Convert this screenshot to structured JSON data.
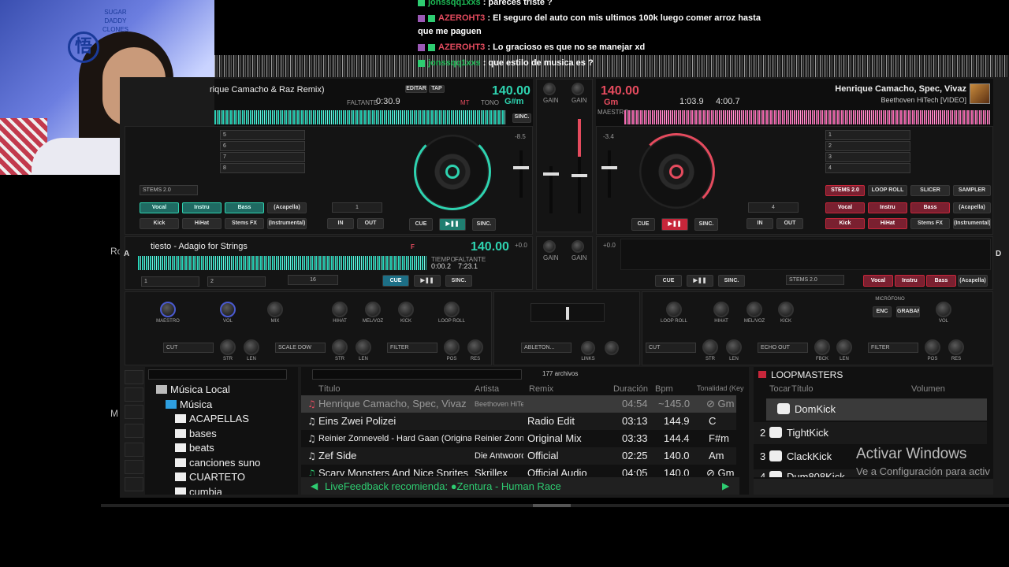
{
  "chat": {
    "messages": [
      {
        "user": "jonssqq1xxs",
        "text": "pareces triste ?"
      },
      {
        "user": "AZEROHT3",
        "text": "El seguro del auto con mis ultimos 100k luego comer arroz hasta"
      },
      {
        "user": "",
        "text": "que me paguen"
      },
      {
        "user": "AZEROHT3",
        "text": "Lo gracioso es que no se manejar xd"
      },
      {
        "user": "jonssqq1xxs",
        "text": "que estilo de musica es ?"
      }
    ]
  },
  "webcam": {
    "logo": "悟",
    "text": "SUGAR\nDADDY\nCLONES"
  },
  "deckA": {
    "title": "rique Camacho & Raz Remix)",
    "bpm": "140.00",
    "key": "G#m",
    "remaining_label": "FALTANTE",
    "remaining": "0:30.9",
    "edit_label": "EDITAR",
    "tap_label": "TAP",
    "mt_label": "MT",
    "tone_label": "TONO",
    "sync_label": "SINC.",
    "pitch": "-8.5",
    "stems": "STEMS 2.0",
    "stem_buttons": [
      "Vocal",
      "Instru",
      "Bass",
      "(Acapella)",
      "Kick",
      "HiHat",
      "Stems FX",
      "(Instrumental)"
    ],
    "loop_value": "1",
    "in_label": "IN",
    "out_label": "OUT",
    "cue_label": "CUE",
    "gain_label": "GAIN",
    "pads": [
      "5",
      "6",
      "7",
      "8"
    ]
  },
  "deckB": {
    "title": "Henrique Camacho, Spec, Vivaz",
    "subtitle": "Beethoven HiTech [VIDEO]",
    "bpm": "140.00",
    "key": "Gm",
    "elapsed": "1:03.9",
    "total": "4:00.7",
    "maestro_label": "MAESTRO",
    "pitch": "-3.4",
    "stems": "STEMS 2.0",
    "top_buttons": [
      "LOOP ROLL",
      "SLICER",
      "SAMPLER"
    ],
    "stem_buttons": [
      "Vocal",
      "Instru",
      "Bass",
      "(Acapella)",
      "Kick",
      "HiHat",
      "Stems FX",
      "(Instrumental)"
    ],
    "loop_value": "4",
    "in_label": "IN",
    "out_label": "OUT",
    "cue_label": "CUE",
    "sync_label": "SINC.",
    "pads": [
      "1",
      "2",
      "3",
      "4"
    ]
  },
  "deckC": {
    "letter": "A",
    "title": "tiesto - Adagio for Strings",
    "bpm": "140.00",
    "key": "F",
    "elapsed_label": "TIEMPO",
    "elapsed": "0:00.2",
    "remaining_label": "FALTANTE",
    "remaining": "7:23.1",
    "loop_value": "16",
    "cue_label": "CUE",
    "sync_label": "SINC.",
    "pitch": "+0.0",
    "pads": [
      "1",
      "2"
    ]
  },
  "deckD": {
    "letter": "D",
    "pitch": "+0.0",
    "stems": "STEMS 2.0",
    "stem_buttons": [
      "Vocal",
      "Instru",
      "Bass",
      "(Acapella)"
    ],
    "cue_label": "CUE",
    "sync_label": "SINC."
  },
  "fx_left": {
    "maestro": "MAESTRO",
    "vol": "VOL",
    "mix": "MIX",
    "knobs": [
      "HIHAT",
      "MEL/VOZ",
      "KICK",
      "LOOP ROLL"
    ],
    "cut": "CUT",
    "scale": "SCALE DOW",
    "filter": "FILTER",
    "str": "STR",
    "len": "LEN",
    "pos": "POS",
    "res": "RES"
  },
  "fx_right": {
    "knobs": [
      "LOOP ROLL",
      "HIHAT",
      "MEL/VOZ",
      "KICK"
    ],
    "microfono": "MICRÓFONO",
    "enc": "ENC",
    "grabar": "GRABAR",
    "vol": "VOL",
    "cut": "CUT",
    "echo": "ECHO OUT",
    "filter": "FILTER",
    "str": "STR",
    "len": "LEN",
    "fbck": "FBCK",
    "pos": "POS",
    "res": "RES"
  },
  "center_fx": {
    "ableton": "ABLETON...",
    "links": "LINKS"
  },
  "browser": {
    "tree": [
      {
        "label": "Música Local",
        "level": 0
      },
      {
        "label": "Música",
        "level": 1
      },
      {
        "label": "ACAPELLAS",
        "level": 2
      },
      {
        "label": "bases",
        "level": 2
      },
      {
        "label": "beats",
        "level": 2
      },
      {
        "label": "canciones suno",
        "level": 2
      },
      {
        "label": "CUARTETO",
        "level": 2
      },
      {
        "label": "cumbia",
        "level": 2
      }
    ],
    "count": "177 archivos",
    "columns": [
      "Título",
      "Artista",
      "Remix",
      "Duración",
      "Bpm",
      "Tonalidad (Key"
    ],
    "rows": [
      {
        "title": "Henrique Camacho, Spec, Vivaz",
        "artist": "Beethoven HiTec",
        "remix": "",
        "duration": "04:54",
        "bpm": "~145.0",
        "key": "Gm"
      },
      {
        "title": "Eins Zwei Polizei",
        "artist": "",
        "remix": "Radio Edit",
        "duration": "03:13",
        "bpm": "144.9",
        "key": "C"
      },
      {
        "title": "Reinier Zonneveld - Hard Gaan (Original Mix)",
        "artist": "Reinier Zonn...",
        "remix": "Original Mix",
        "duration": "03:33",
        "bpm": "144.4",
        "key": "F#m"
      },
      {
        "title": "Zef Side",
        "artist": "Die Antwoord",
        "remix": "Official",
        "duration": "02:25",
        "bpm": "140.0",
        "key": "Am"
      },
      {
        "title": "Scary Monsters And Nice Sprites",
        "artist": "Skrillex",
        "remix": "Official Audio",
        "duration": "04:05",
        "bpm": "140.0",
        "key": "Gm"
      }
    ],
    "livefeedback": "LiveFeedback recomienda: ●Zentura - Human Race"
  },
  "sampler": {
    "title": "LOOPMASTERS",
    "col_play": "Tocar",
    "col_title": "Título",
    "col_volume": "Volumen",
    "items": [
      {
        "num": "",
        "name": "DomKick"
      },
      {
        "num": "2",
        "name": "TightKick"
      },
      {
        "num": "3",
        "name": "ClackKick"
      },
      {
        "num": "4",
        "name": "Dum808Kick"
      }
    ]
  },
  "windows": {
    "line1": "Activar Windows",
    "line2": "Ve a Configuración para activ"
  },
  "side_labels": {
    "ro": "Ro",
    "m": "M"
  },
  "colors": {
    "teal": "#2ed3b0",
    "red": "#e54b5e",
    "chat_user": "#1db954"
  }
}
